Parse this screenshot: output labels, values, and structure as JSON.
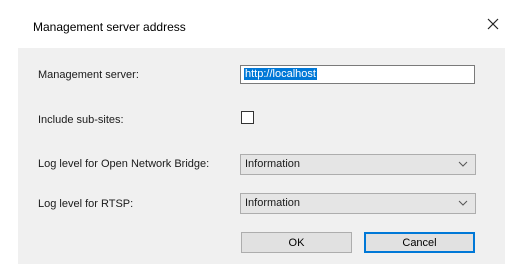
{
  "dialog": {
    "title": "Management server address",
    "close_icon": "close-icon"
  },
  "form": {
    "management_server": {
      "label": "Management server:",
      "value": "http://localhost"
    },
    "include_sub_sites": {
      "label": "Include sub-sites:",
      "checked": false
    },
    "log_level_onb": {
      "label": "Log level for Open Network Bridge:",
      "value": "Information"
    },
    "log_level_rtsp": {
      "label": "Log level for RTSP:",
      "value": "Information"
    }
  },
  "buttons": {
    "ok": "OK",
    "cancel": "Cancel"
  },
  "colors": {
    "client_bg": "#f0f0f0",
    "selection": "#0078d7",
    "default_button_border": "#0078d7"
  }
}
